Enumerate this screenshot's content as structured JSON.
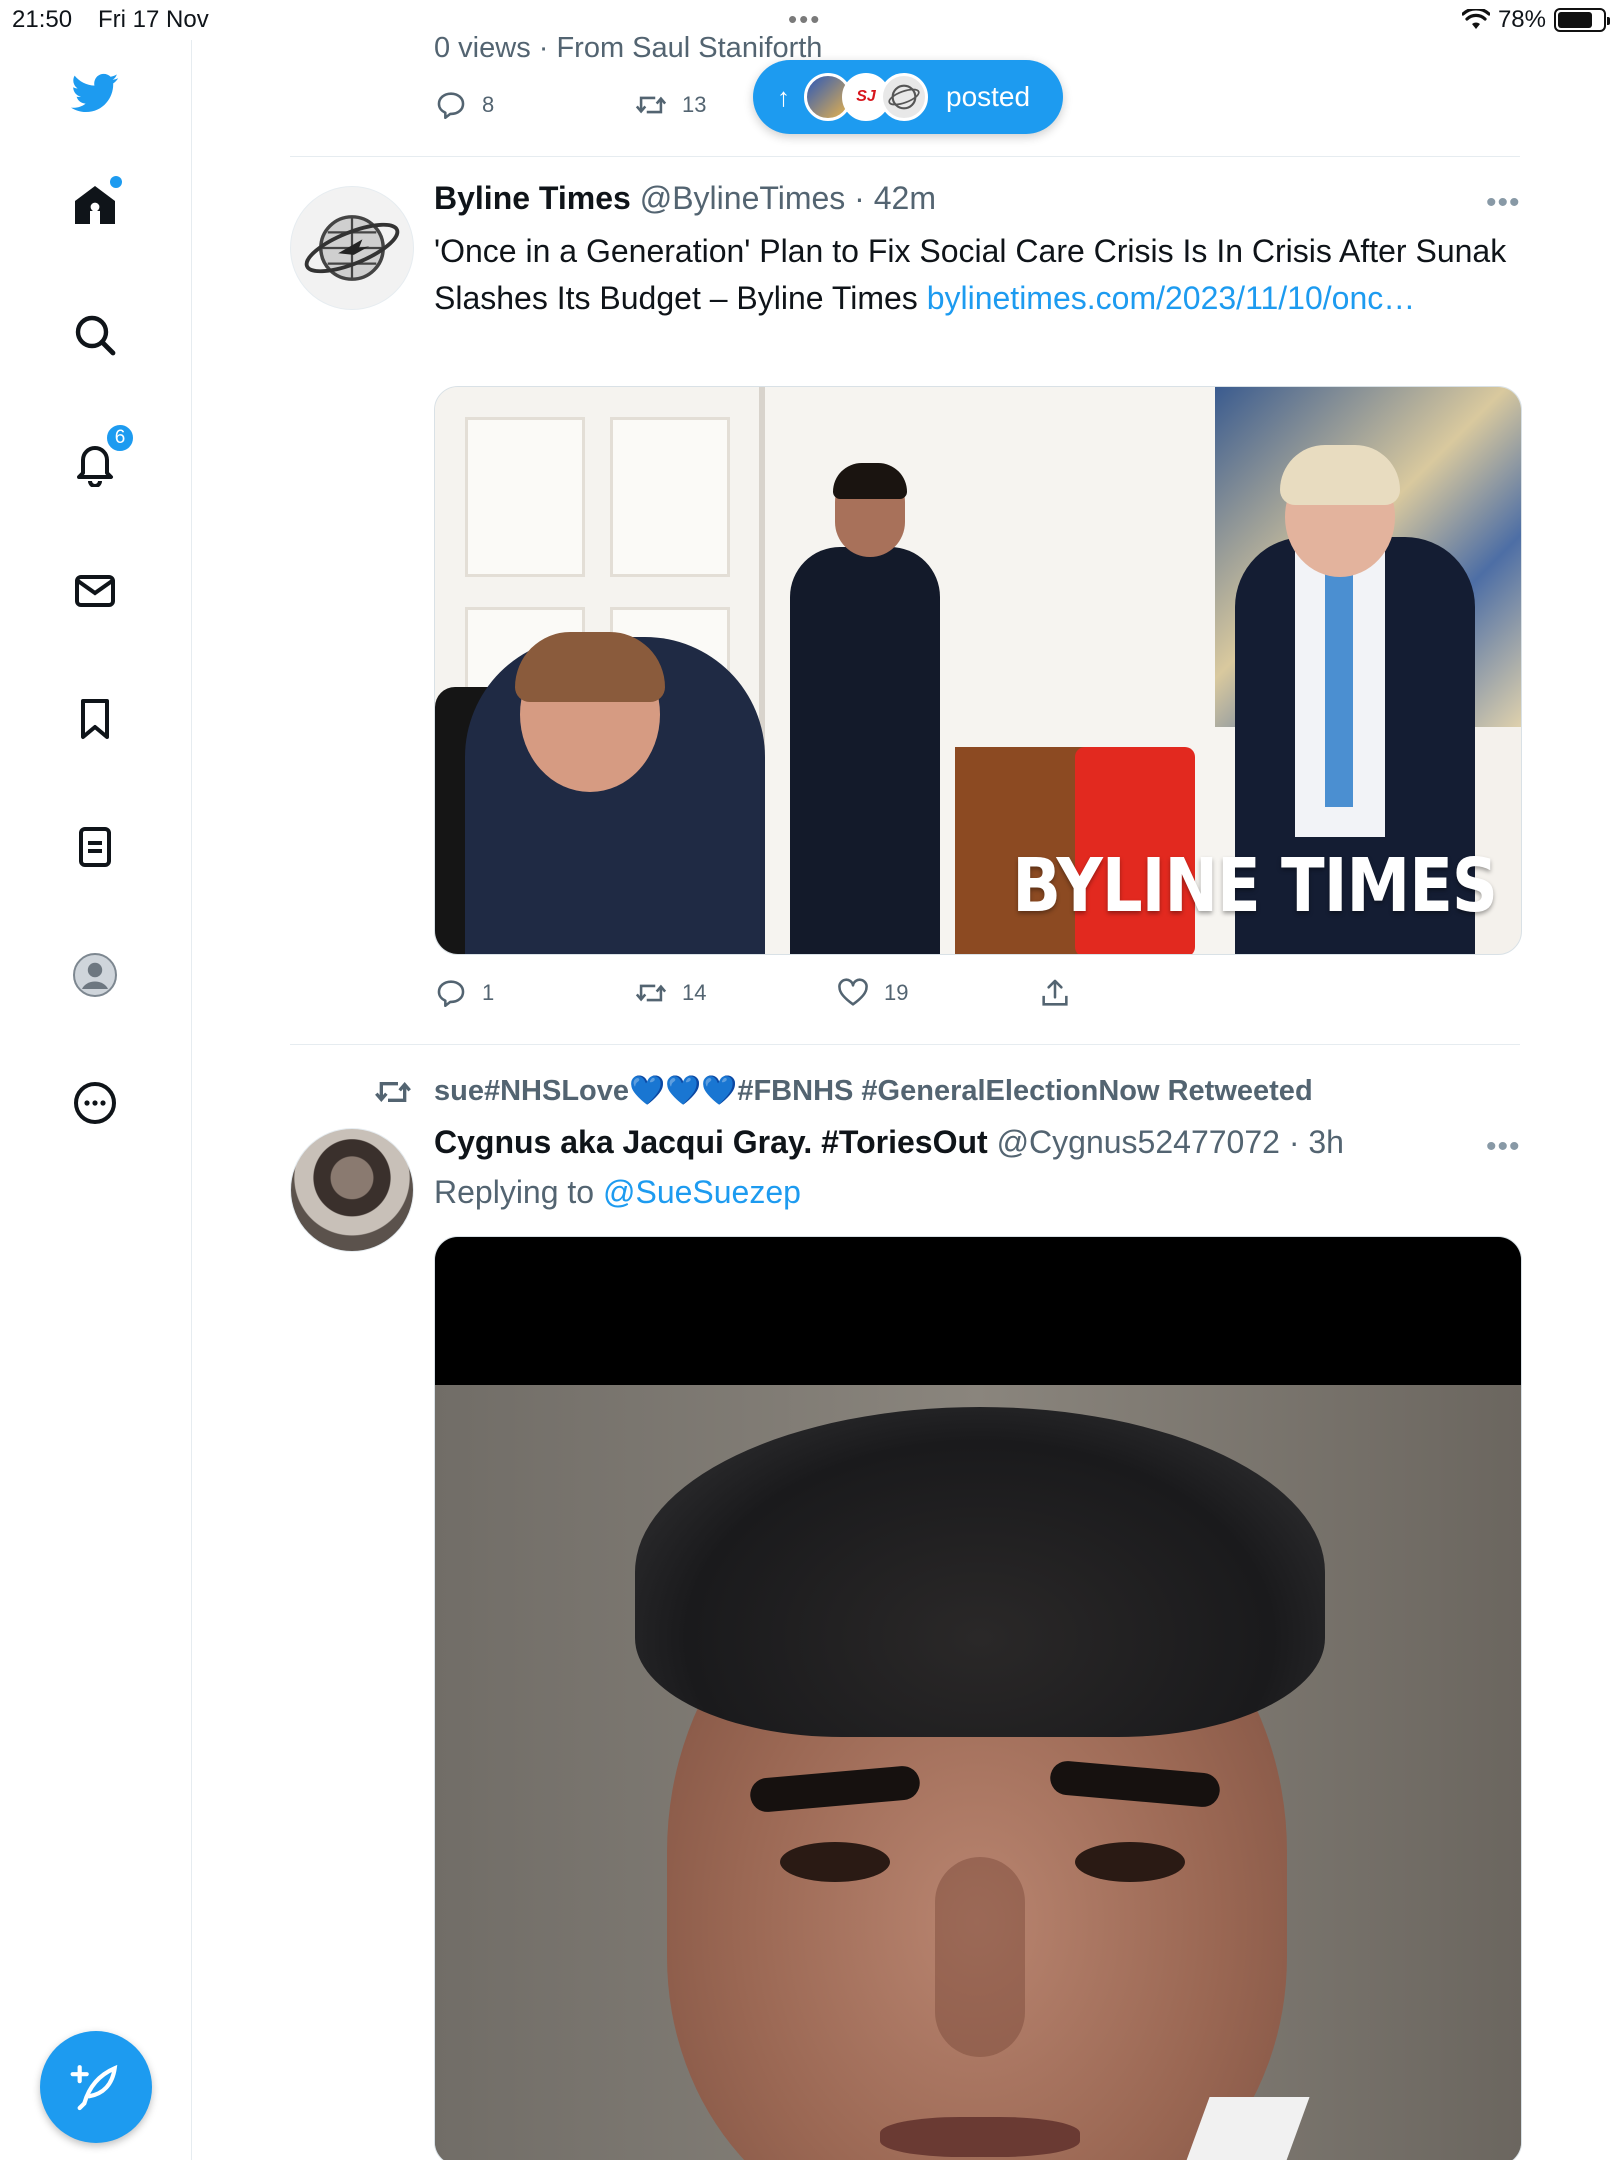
{
  "status": {
    "time": "21:50",
    "date": "Fri 17 Nov",
    "dots": "•••",
    "battery": "78%"
  },
  "nav": {
    "notifications_badge": "6"
  },
  "colors": {
    "accent": "#1d9bf0",
    "text": "#0f1419",
    "muted": "#536471",
    "divider": "#e6ecf0"
  },
  "prev_tweet": {
    "meta": "0 views · From Saul Staniforth",
    "replies": "8",
    "retweets": "13"
  },
  "posted_pill": {
    "arrow": "↑",
    "avatar2_text": "SJ",
    "label": "posted"
  },
  "tweet1": {
    "name": "Byline Times",
    "handle": "@BylineTimes · 42m",
    "text": "'Once in a Generation' Plan to Fix Social Care Crisis Is In Crisis After Sunak Slashes Its Budget – Byline Times ",
    "link": "bylinetimes.com/2023/11/10/onc…",
    "image_watermark": "BYLINE TIMES",
    "replies": "1",
    "retweets": "14",
    "likes": "19",
    "more": "•••"
  },
  "tweet2": {
    "retweeted_by": "sue#NHSLove💙💙💙#FBNHS #GeneralElectionNow Retweeted",
    "name": "Cygnus aka Jacqui Gray. #ToriesOut",
    "handle": "@Cygnus52477072 · 3h",
    "replying_prefix": "Replying to ",
    "replying_to": "@SueSuezep",
    "more": "•••"
  }
}
